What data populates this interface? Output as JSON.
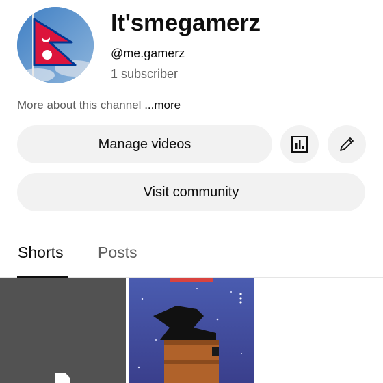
{
  "channel": {
    "name": "It'smegamerz",
    "handle": "@me.gamerz",
    "subscribers": "1 subscriber",
    "about_text": "More about this channel",
    "about_more": "...more"
  },
  "actions": {
    "manage_videos": "Manage videos",
    "visit_community": "Visit community",
    "stats_icon": "analytics-icon",
    "edit_icon": "pencil-icon"
  },
  "tabs": [
    {
      "label": "Shorts",
      "selected": true
    },
    {
      "label": "Posts",
      "selected": false
    }
  ],
  "colors": {
    "flag_red": "#dc143c",
    "flag_blue": "#003893",
    "pill_bg": "#f2f2f2",
    "secondary_text": "#606060"
  }
}
